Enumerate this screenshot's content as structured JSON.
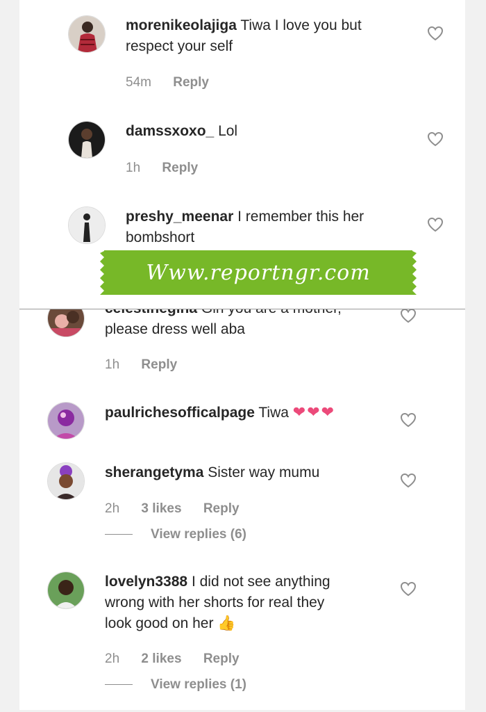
{
  "watermark": "Www.reportngr.com",
  "colors": {
    "accent_green": "#77b828",
    "heart_pink": "#ec4a7a",
    "meta_gray": "#8e8e8e"
  },
  "comments": [
    {
      "username": "morenikeolajiga",
      "text": "Tiwa I love you but respect your self",
      "line1": "Tiwa I love you but",
      "line2": "respect your self",
      "time": "54m",
      "reply": "Reply"
    },
    {
      "username": "damssxoxo_",
      "text": "Lol",
      "time": "1h",
      "reply": "Reply"
    },
    {
      "username": "preshy_meenar",
      "text": "I remember this her bombshort",
      "line1": "I remember this her",
      "line2": "bombshort"
    },
    {
      "username": "celestinegina",
      "text": "Girl you are a mother, please dress well aba",
      "line1": "Girl you are a mother,",
      "line2": "please dress well aba",
      "time": "1h",
      "reply": "Reply"
    },
    {
      "username": "paulrichesofficalpage",
      "text": "Tiwa",
      "emoji": "❤❤❤"
    },
    {
      "username": "sherangetyma",
      "text": "Sister way mumu",
      "time": "2h",
      "likes": "3 likes",
      "reply": "Reply",
      "view_replies": "View replies (6)"
    },
    {
      "username": "lovelyn3388",
      "text": "I did not see anything wrong with her shorts for real they look good on her",
      "line1": "I did not see anything",
      "line2": "wrong with her shorts for real they",
      "line3": "look good on her",
      "emoji": "👍",
      "time": "2h",
      "likes": "2 likes",
      "reply": "Reply",
      "view_replies": "View replies (1)"
    }
  ],
  "icons": {
    "like": "heart-outline-icon",
    "thumbs": "thumbs-up-icon"
  }
}
